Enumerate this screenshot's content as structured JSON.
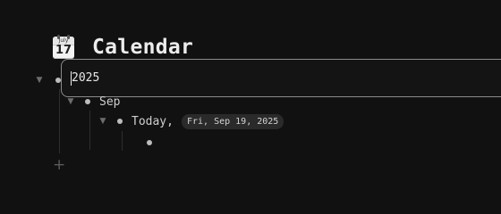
{
  "header": {
    "title": "Calendar",
    "icon": "calendar-icon",
    "icon_month": "July",
    "icon_day": "17"
  },
  "outline": {
    "year": {
      "text": "2025",
      "editing": true
    },
    "month": {
      "label": "Sep"
    },
    "day": {
      "label": "Today,",
      "date_chip": "Fri, Sep 19, 2025"
    }
  },
  "colors": {
    "background": "#111111",
    "text": "#cfcfcf",
    "chip_bg": "#2a2a2a",
    "edit_border": "#8a8a8a"
  },
  "actions": {
    "add_icon": "plus-icon"
  }
}
